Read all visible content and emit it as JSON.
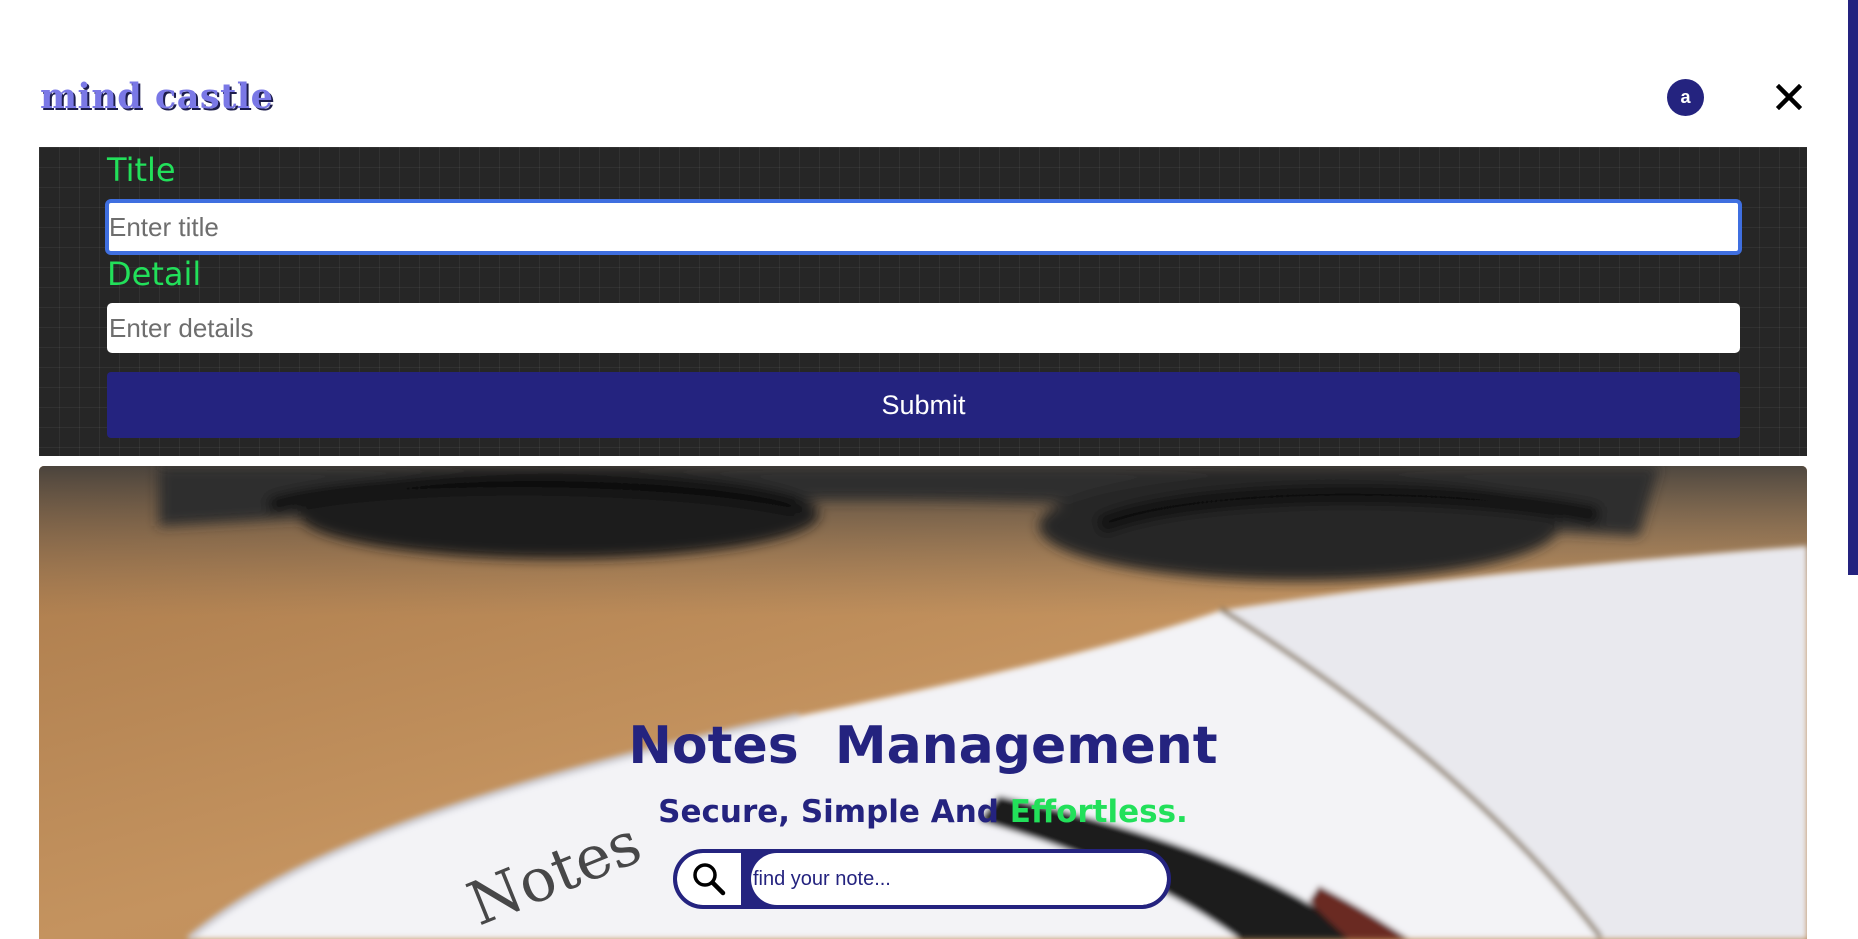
{
  "header": {
    "logo_text": "mind castle",
    "avatar_initial": "a",
    "close_icon": "close-icon"
  },
  "form": {
    "title_label": "Title",
    "title_placeholder": "Enter title",
    "detail_label": "Detail",
    "detail_placeholder": "Enter details",
    "submit_label": "Submit"
  },
  "hero": {
    "title": "Notes Management",
    "subtitle_main": "Secure, Simple And ",
    "subtitle_accent": "Effortless.",
    "search_icon": "search-icon",
    "search_placeholder": "find your note..."
  },
  "colors": {
    "brand": "#24237f",
    "accent": "#22e05a",
    "focus": "#3f6fe0",
    "panel": "#262626"
  }
}
